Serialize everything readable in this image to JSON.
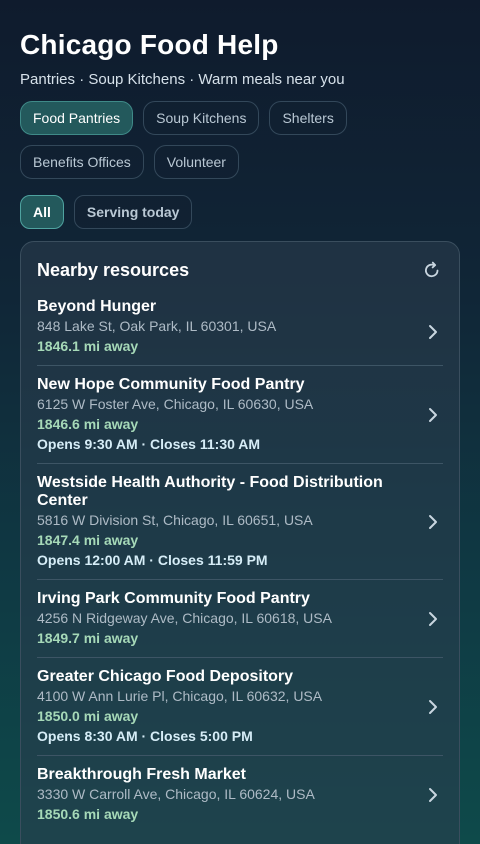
{
  "header": {
    "title": "Chicago Food Help",
    "subtitle": "Pantries · Soup Kitchens · Warm meals near you"
  },
  "categories": [
    {
      "label": "Food Pantries",
      "active": true
    },
    {
      "label": "Soup Kitchens",
      "active": false
    },
    {
      "label": "Shelters",
      "active": false
    },
    {
      "label": "Benefits Offices",
      "active": false
    },
    {
      "label": "Volunteer",
      "active": false
    }
  ],
  "filters": [
    {
      "label": "All",
      "active": true
    },
    {
      "label": "Serving today",
      "active": false
    }
  ],
  "panel": {
    "title": "Nearby resources",
    "refresh_icon": "refresh-icon"
  },
  "resources": [
    {
      "name": "Beyond Hunger",
      "address": "848 Lake St, Oak Park, IL 60301, USA",
      "distance": "1846.1 mi away",
      "hours": ""
    },
    {
      "name": "New Hope Community Food Pantry",
      "address": "6125 W Foster Ave, Chicago, IL 60630, USA",
      "distance": "1846.6 mi away",
      "hours": "Opens 9:30 AM · Closes 11:30 AM"
    },
    {
      "name": "Westside Health Authority - Food Distribution Center",
      "address": "5816 W Division St, Chicago, IL 60651, USA",
      "distance": "1847.4 mi away",
      "hours": "Opens 12:00 AM · Closes 11:59 PM"
    },
    {
      "name": "Irving Park Community Food Pantry",
      "address": "4256 N Ridgeway Ave, Chicago, IL 60618, USA",
      "distance": "1849.7 mi away",
      "hours": ""
    },
    {
      "name": "Greater Chicago Food Depository",
      "address": "4100 W Ann Lurie Pl, Chicago, IL 60632, USA",
      "distance": "1850.0 mi away",
      "hours": "Opens 8:30 AM · Closes 5:00 PM"
    },
    {
      "name": "Breakthrough Fresh Market",
      "address": "3330 W Carroll Ave, Chicago, IL 60624, USA",
      "distance": "1850.6 mi away",
      "hours": ""
    }
  ],
  "colors": {
    "accent": "#23595c",
    "distance": "#a6d9b8",
    "hours": "#d6edf7"
  }
}
